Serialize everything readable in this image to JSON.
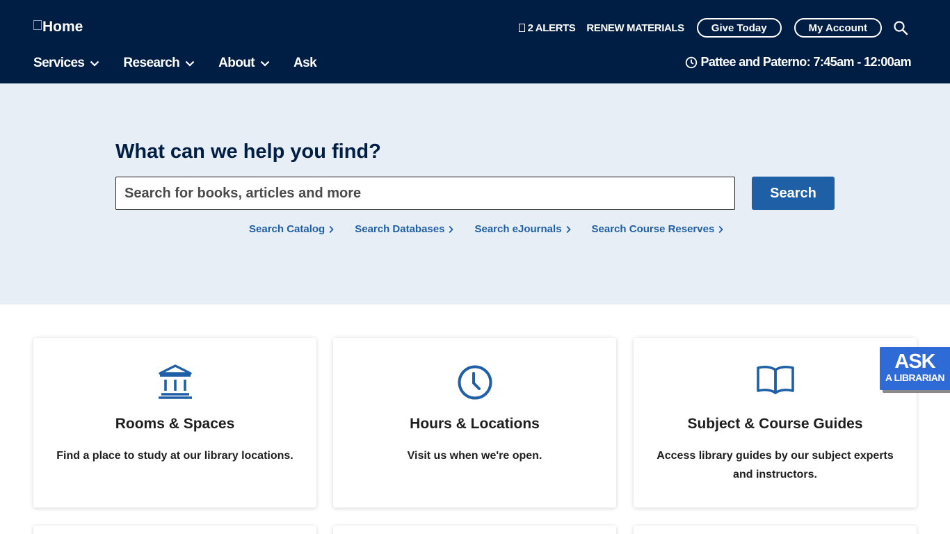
{
  "header": {
    "logo_alt": "Home",
    "alerts": "2 ALERTS",
    "renew": "RENEW MATERIALS",
    "give": "Give Today",
    "account": "My Account",
    "nav": [
      "Services",
      "Research",
      "About",
      "Ask"
    ],
    "hours": "Pattee and Paterno: 7:45am - 12:00am"
  },
  "search": {
    "title": "What can we help you find?",
    "placeholder": "Search for books, articles and more",
    "button": "Search",
    "links": [
      "Search Catalog",
      "Search Databases",
      "Search eJournals",
      "Search Course Reserves"
    ]
  },
  "cards": [
    {
      "icon": "library-building-icon",
      "title": "Rooms & Spaces",
      "desc": "Find a place to study at our library locations."
    },
    {
      "icon": "clock-icon",
      "title": "Hours & Locations",
      "desc": "Visit us when we're open."
    },
    {
      "icon": "open-book-icon",
      "title": "Subject & Course Guides",
      "desc": "Access library guides by our subject experts and instructors."
    }
  ],
  "ask_widget": {
    "big": "ASK",
    "small": "A LIBRARIAN"
  },
  "colors": {
    "header_bg": "#001e44",
    "hero_bg": "#e8eef5",
    "accent": "#1e5fa6",
    "ask_bg": "#2e6bd6"
  }
}
